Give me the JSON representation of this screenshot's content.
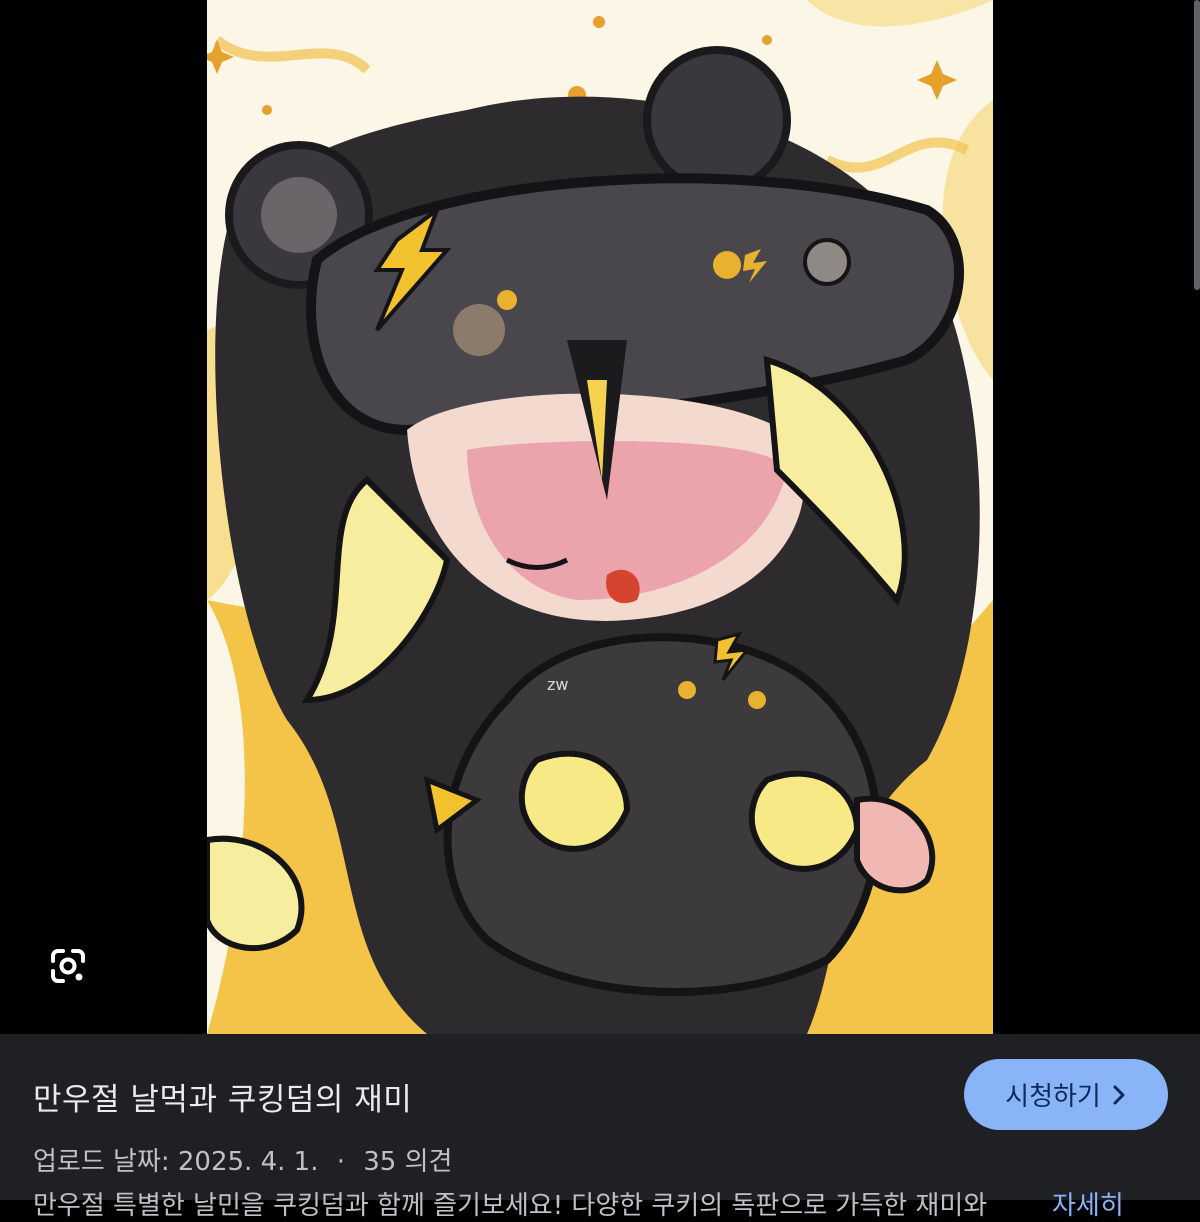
{
  "viewer": {
    "image_subject": "cartoon character with bear-ear sleep mask and lightning bolts",
    "lens_icon": "google-lens-icon"
  },
  "video": {
    "title": "만우절 날먹과 쿠킹덤의 재미",
    "upload_label": "업로드 날짜:",
    "upload_date": "2025. 4. 1.",
    "separator": "·",
    "comments": "35 의견",
    "description": "만우절 특별한 날민을 쿠킹덤과 함께 즐기보세요! 다양한 쿠키의 독판으로 가득한 재미와",
    "more_label": "자세히"
  },
  "actions": {
    "watch_label": "시청하기",
    "watch_icon": "chevron-right-icon"
  },
  "colors": {
    "background": "#000000",
    "panel": "#1f2023",
    "accent": "#8ab4f8",
    "text_primary": "#e8eaed",
    "text_secondary": "#bdc1c6"
  }
}
